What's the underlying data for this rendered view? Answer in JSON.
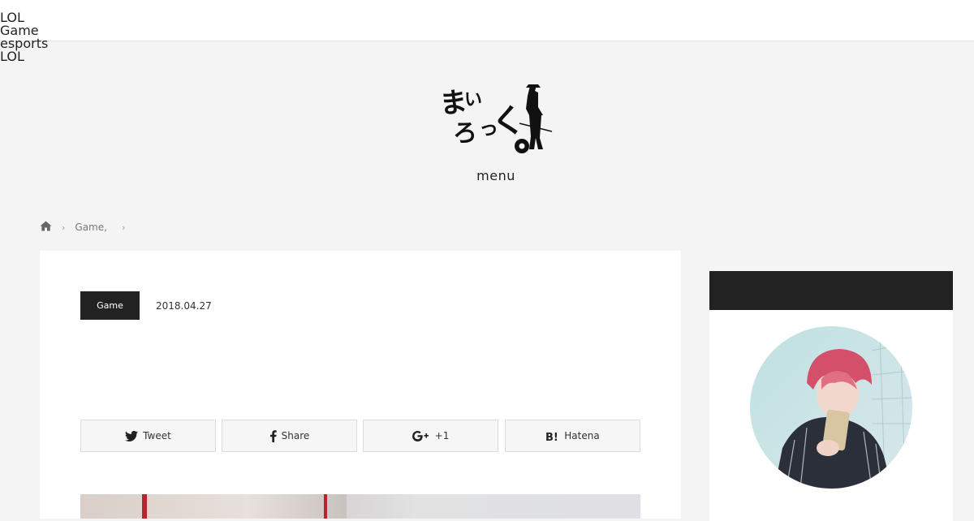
{
  "header": {
    "tags": [
      "LOL",
      "Game",
      "esports",
      "LOL"
    ],
    "logo_text": "まいろっく",
    "menu_label": "menu"
  },
  "breadcrumb": {
    "home_icon": "home-icon",
    "items": [
      "Game,"
    ]
  },
  "article": {
    "category": "Game",
    "date": "2018.04.27",
    "share": {
      "tweet": "Tweet",
      "share": "Share",
      "gplus": "+1",
      "hatena": "Hatena"
    }
  },
  "colors": {
    "page_bg": "#f4f4f4",
    "badge_bg": "#222222",
    "sidebar_head": "#222222"
  }
}
